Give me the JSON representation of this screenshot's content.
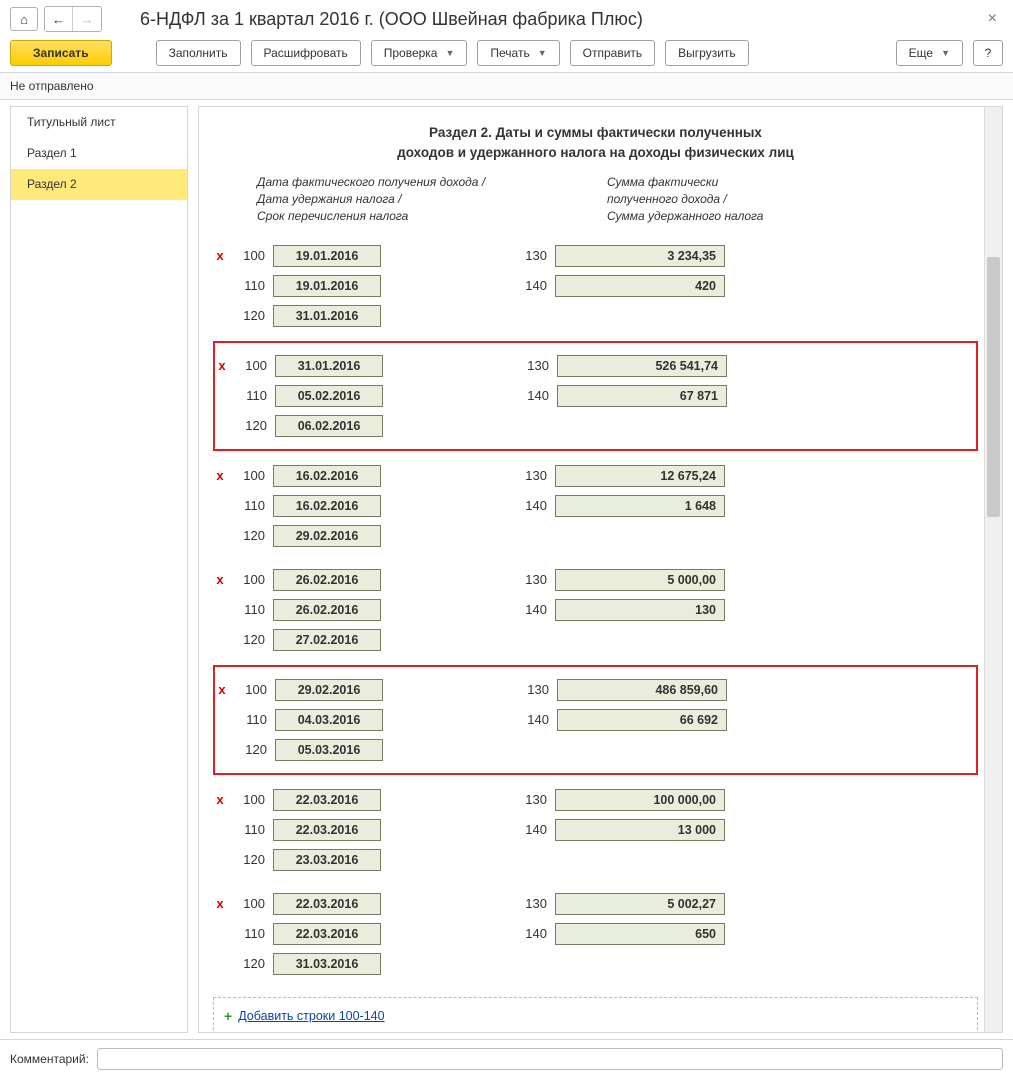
{
  "header": {
    "title": "6-НДФЛ за 1 квартал 2016 г. (ООО Швейная фабрика Плюс)"
  },
  "toolbar": {
    "write": "Записать",
    "fill": "Заполнить",
    "decode": "Расшифровать",
    "check": "Проверка",
    "print": "Печать",
    "send": "Отправить",
    "export": "Выгрузить",
    "more": "Еще",
    "help": "?"
  },
  "status": "Не отправлено",
  "sidebar": {
    "items": [
      {
        "label": "Титульный лист"
      },
      {
        "label": "Раздел 1"
      },
      {
        "label": "Раздел 2"
      }
    ],
    "active_index": 2
  },
  "section2": {
    "title_l1": "Раздел 2.  Даты и суммы фактически полученных",
    "title_l2": "доходов и удержанного налога на доходы физических лиц",
    "col_left_l1": "Дата фактического получения дохода /",
    "col_left_l2": "Дата удержания налога /",
    "col_left_l3": "Срок перечисления налога",
    "col_right_l1": "Сумма фактически",
    "col_right_l2": "полученного дохода /",
    "col_right_l3": "Сумма удержанного налога",
    "codes": {
      "r100": "100",
      "r110": "110",
      "r120": "120",
      "r130": "130",
      "r140": "140"
    },
    "blocks": [
      {
        "highlight": false,
        "d100": "19.01.2016",
        "d110": "19.01.2016",
        "d120": "31.01.2016",
        "s130": "3 234,35",
        "s140": "420"
      },
      {
        "highlight": true,
        "d100": "31.01.2016",
        "d110": "05.02.2016",
        "d120": "06.02.2016",
        "s130": "526 541,74",
        "s140": "67 871"
      },
      {
        "highlight": false,
        "d100": "16.02.2016",
        "d110": "16.02.2016",
        "d120": "29.02.2016",
        "s130": "12 675,24",
        "s140": "1 648"
      },
      {
        "highlight": false,
        "d100": "26.02.2016",
        "d110": "26.02.2016",
        "d120": "27.02.2016",
        "s130": "5 000,00",
        "s140": "130"
      },
      {
        "highlight": true,
        "d100": "29.02.2016",
        "d110": "04.03.2016",
        "d120": "05.03.2016",
        "s130": "486 859,60",
        "s140": "66 692"
      },
      {
        "highlight": false,
        "d100": "22.03.2016",
        "d110": "22.03.2016",
        "d120": "23.03.2016",
        "s130": "100 000,00",
        "s140": "13 000"
      },
      {
        "highlight": false,
        "d100": "22.03.2016",
        "d110": "22.03.2016",
        "d120": "31.03.2016",
        "s130": "5 002,27",
        "s140": "650"
      }
    ],
    "add_rows": "Добавить строки 100-140"
  },
  "footer": {
    "comment_label": "Комментарий:",
    "comment_value": ""
  }
}
